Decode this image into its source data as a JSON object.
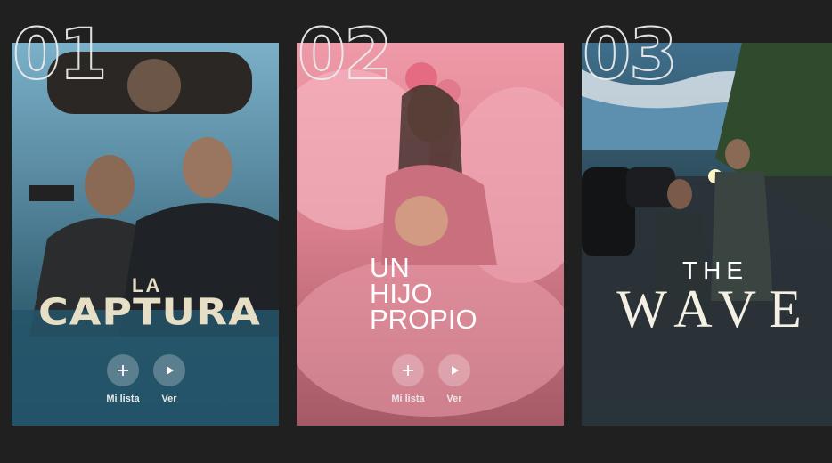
{
  "titles": [
    {
      "rank": "01",
      "title_lines": [
        "LA",
        "CAPTURA"
      ],
      "actions": {
        "add_label": "Mi lista",
        "play_label": "Ver"
      }
    },
    {
      "rank": "02",
      "title_lines": [
        "UN",
        "HIJO",
        "PROPIO"
      ],
      "actions": {
        "add_label": "Mi lista",
        "play_label": "Ver"
      }
    },
    {
      "rank": "03",
      "title_lines": [
        "THE",
        "WAVE"
      ]
    }
  ],
  "colors": {
    "background": "#202020",
    "button_fill": "rgba(255,255,255,0.25)",
    "label": "#e8e8e8"
  },
  "icons": {
    "add": "plus-icon",
    "play": "play-icon"
  }
}
